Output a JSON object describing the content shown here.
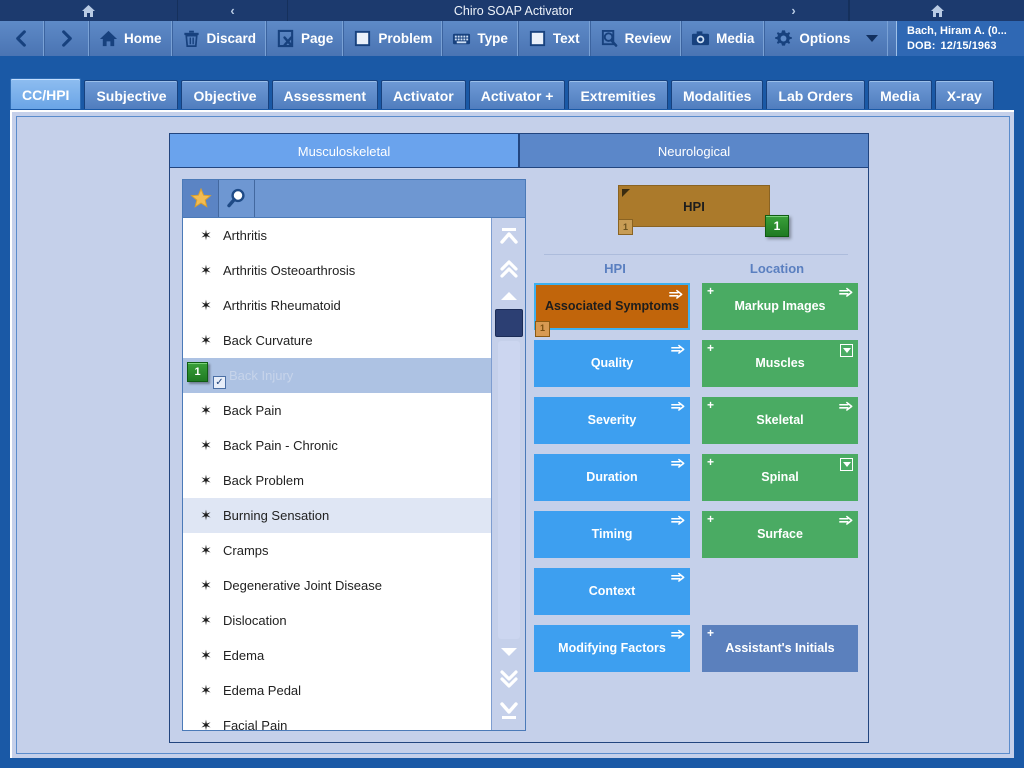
{
  "titlebar": {
    "title": "Chiro SOAP Activator",
    "left_icon": "home-icon",
    "prev_chevron": "‹",
    "next_chevron": "›",
    "right_icon": "home-icon"
  },
  "toolbar": {
    "back_label": "‹",
    "forward_label": "›",
    "buttons": [
      {
        "label": "Home",
        "icon": "home-icon"
      },
      {
        "label": "Discard",
        "icon": "trash-icon"
      },
      {
        "label": "Page",
        "icon": "page-x-icon"
      },
      {
        "label": "Problem",
        "icon": "window-icon"
      },
      {
        "label": "Type",
        "icon": "keyboard-icon"
      },
      {
        "label": "Text",
        "icon": "window-icon"
      },
      {
        "label": "Review",
        "icon": "magnifier-doc-icon"
      },
      {
        "label": "Media",
        "icon": "camera-icon"
      },
      {
        "label": "Options",
        "icon": "gear-icon"
      }
    ],
    "patient": {
      "name": "Bach, Hiram A. (0...",
      "dob_label": "DOB:",
      "dob_value": "12/15/1963"
    }
  },
  "tabs": [
    {
      "label": "CC/HPI",
      "active": true
    },
    {
      "label": "Subjective",
      "active": false
    },
    {
      "label": "Objective",
      "active": false
    },
    {
      "label": "Assessment",
      "active": false
    },
    {
      "label": "Activator",
      "active": false
    },
    {
      "label": "Activator +",
      "active": false
    },
    {
      "label": "Extremities",
      "active": false
    },
    {
      "label": "Modalities",
      "active": false
    },
    {
      "label": "Lab Orders",
      "active": false
    },
    {
      "label": "Media",
      "active": false
    },
    {
      "label": "X-ray",
      "active": false
    }
  ],
  "subtabs": [
    {
      "label": "Musculoskeletal",
      "active": true
    },
    {
      "label": "Neurological",
      "active": false
    }
  ],
  "list_panel": {
    "header_buttons": [
      {
        "icon": "star-icon",
        "selected": true
      },
      {
        "icon": "magnifier-icon",
        "selected": false
      }
    ],
    "items": [
      {
        "label": "Arthritis",
        "state": "normal"
      },
      {
        "label": "Arthritis Osteoarthrosis",
        "state": "normal"
      },
      {
        "label": "Arthritis Rheumatoid",
        "state": "normal"
      },
      {
        "label": "Back Curvature",
        "state": "normal"
      },
      {
        "label": "Back Injury",
        "state": "selected",
        "badge": "1",
        "checked": true
      },
      {
        "label": "Back Pain",
        "state": "normal"
      },
      {
        "label": "Back Pain - Chronic",
        "state": "normal"
      },
      {
        "label": "Back Problem",
        "state": "normal"
      },
      {
        "label": "Burning Sensation",
        "state": "alt"
      },
      {
        "label": "Cramps",
        "state": "normal"
      },
      {
        "label": "Degenerative Joint Disease",
        "state": "normal"
      },
      {
        "label": "Dislocation",
        "state": "normal"
      },
      {
        "label": "Edema",
        "state": "normal"
      },
      {
        "label": "Edema Pedal",
        "state": "normal"
      },
      {
        "label": "Facial Pain",
        "state": "normal"
      }
    ],
    "item_bullet": "✶",
    "checkmark": "✓",
    "scrollbar": {
      "top_icon": "scroll-to-top-icon",
      "page_up_icon": "page-up-icon",
      "line_up_icon": "line-up-icon",
      "line_down_icon": "line-down-icon",
      "page_down_icon": "page-down-icon",
      "bottom_icon": "scroll-to-bottom-icon"
    }
  },
  "detail_panel": {
    "header_box": {
      "label": "HPI",
      "badge": "1",
      "mini": "1"
    },
    "columns": [
      {
        "label": "HPI"
      },
      {
        "label": "Location"
      }
    ],
    "rows": [
      [
        {
          "label": "Associated Symptoms",
          "color": "orange",
          "selected": true,
          "arrow": true,
          "plus": false,
          "dropdown": false,
          "mini": "1"
        },
        {
          "label": "Markup Images",
          "color": "green",
          "selected": false,
          "arrow": true,
          "plus": true,
          "dropdown": false
        }
      ],
      [
        {
          "label": "Quality",
          "color": "blue",
          "selected": false,
          "arrow": true,
          "plus": false,
          "dropdown": false
        },
        {
          "label": "Muscles",
          "color": "green",
          "selected": false,
          "arrow": false,
          "plus": true,
          "dropdown": true
        }
      ],
      [
        {
          "label": "Severity",
          "color": "blue",
          "selected": false,
          "arrow": true,
          "plus": false,
          "dropdown": false
        },
        {
          "label": "Skeletal",
          "color": "green",
          "selected": false,
          "arrow": true,
          "plus": true,
          "dropdown": false
        }
      ],
      [
        {
          "label": "Duration",
          "color": "blue",
          "selected": false,
          "arrow": true,
          "plus": false,
          "dropdown": false
        },
        {
          "label": "Spinal",
          "color": "green",
          "selected": false,
          "arrow": false,
          "plus": true,
          "dropdown": true
        }
      ],
      [
        {
          "label": "Timing",
          "color": "blue",
          "selected": false,
          "arrow": true,
          "plus": false,
          "dropdown": false
        },
        {
          "label": "Surface",
          "color": "green",
          "selected": false,
          "arrow": true,
          "plus": true,
          "dropdown": false
        }
      ],
      [
        {
          "label": "Context",
          "color": "blue",
          "selected": false,
          "arrow": true,
          "plus": false,
          "dropdown": false
        },
        {
          "label": "",
          "color": "empty",
          "selected": false,
          "arrow": false,
          "plus": false,
          "dropdown": false
        }
      ],
      [
        {
          "label": "Modifying Factors",
          "color": "blue",
          "selected": false,
          "arrow": true,
          "plus": false,
          "dropdown": false
        },
        {
          "label": "Assistant's Initials",
          "color": "slate",
          "selected": false,
          "arrow": false,
          "plus": true,
          "dropdown": false
        }
      ]
    ]
  },
  "colors": {
    "window_bg": "#1a59a6",
    "titlebar": "#1c3a6e",
    "toolbar": "#5b87c4",
    "content_bg": "#c5d0ea",
    "tab_active": "#8ebdf0",
    "accent_blue": "#3d9ff0",
    "accent_green": "#4aab63",
    "accent_orange": "#c1650b",
    "accent_slate": "#5b80bd",
    "badge_green": "#2e8b32",
    "hpi_brown": "#ab7a2b"
  }
}
